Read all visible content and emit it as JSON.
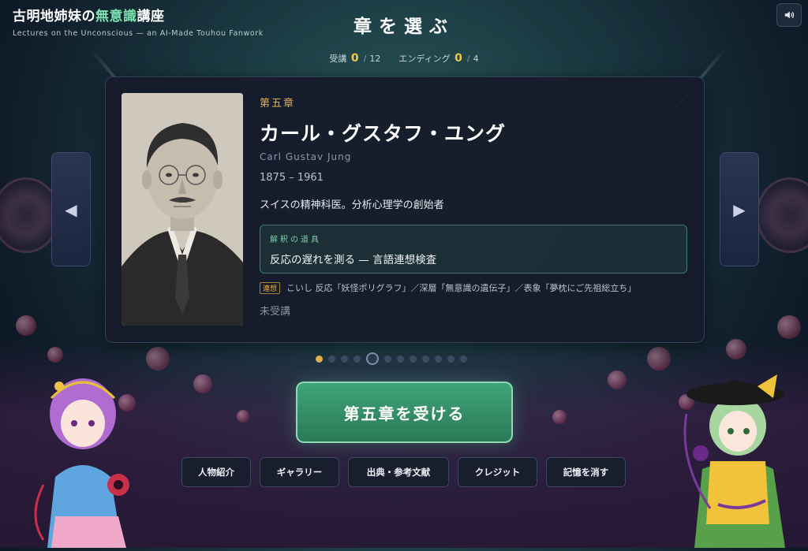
{
  "brand": {
    "title_pre": "古明地姉妹の",
    "title_accent": "無意識",
    "title_post": "講座",
    "subtitle": "Lectures on the Unconscious — an AI-Made Touhou Fanwork"
  },
  "header": {
    "title": "章を選ぶ",
    "progress": {
      "attended_label": "受講",
      "attended_value": "0",
      "attended_total": "12",
      "endings_label": "エンディング",
      "endings_value": "0",
      "endings_total": "4",
      "separator": "/"
    }
  },
  "controls": {
    "sound_icon": "speaker-icon",
    "prev_arrow": "◀",
    "next_arrow": "▶"
  },
  "chapter": {
    "number_label": "第五章",
    "name_ja": "カール・グスタフ・ユング",
    "name_en": "Carl Gustav Jung",
    "years": "1875 – 1961",
    "description": "スイスの精神科医。分析心理学の創始者",
    "tool_label": "解釈の道具",
    "tool_text": "反応の遅れを測る — 言語連想検査",
    "association_tag": "連想",
    "association_text": "こいし 反応「妖怪ポリグラフ」／深層「無意識の遺伝子」／表象「夢枕にご先祖総立ち」",
    "status": "未受講"
  },
  "pagination": {
    "total": 12,
    "current_index": 4,
    "done_indices": [
      0
    ]
  },
  "cta": {
    "label": "第五章を受ける"
  },
  "menu": [
    {
      "id": "characters",
      "label": "人物紹介"
    },
    {
      "id": "gallery",
      "label": "ギャラリー"
    },
    {
      "id": "references",
      "label": "出典・参考文献"
    },
    {
      "id": "credits",
      "label": "クレジット"
    },
    {
      "id": "erase",
      "label": "記憶を消す"
    }
  ],
  "colors": {
    "accent_gold": "#e0b04e",
    "accent_green": "#7de3b0",
    "cta_green": "#3fa378"
  }
}
